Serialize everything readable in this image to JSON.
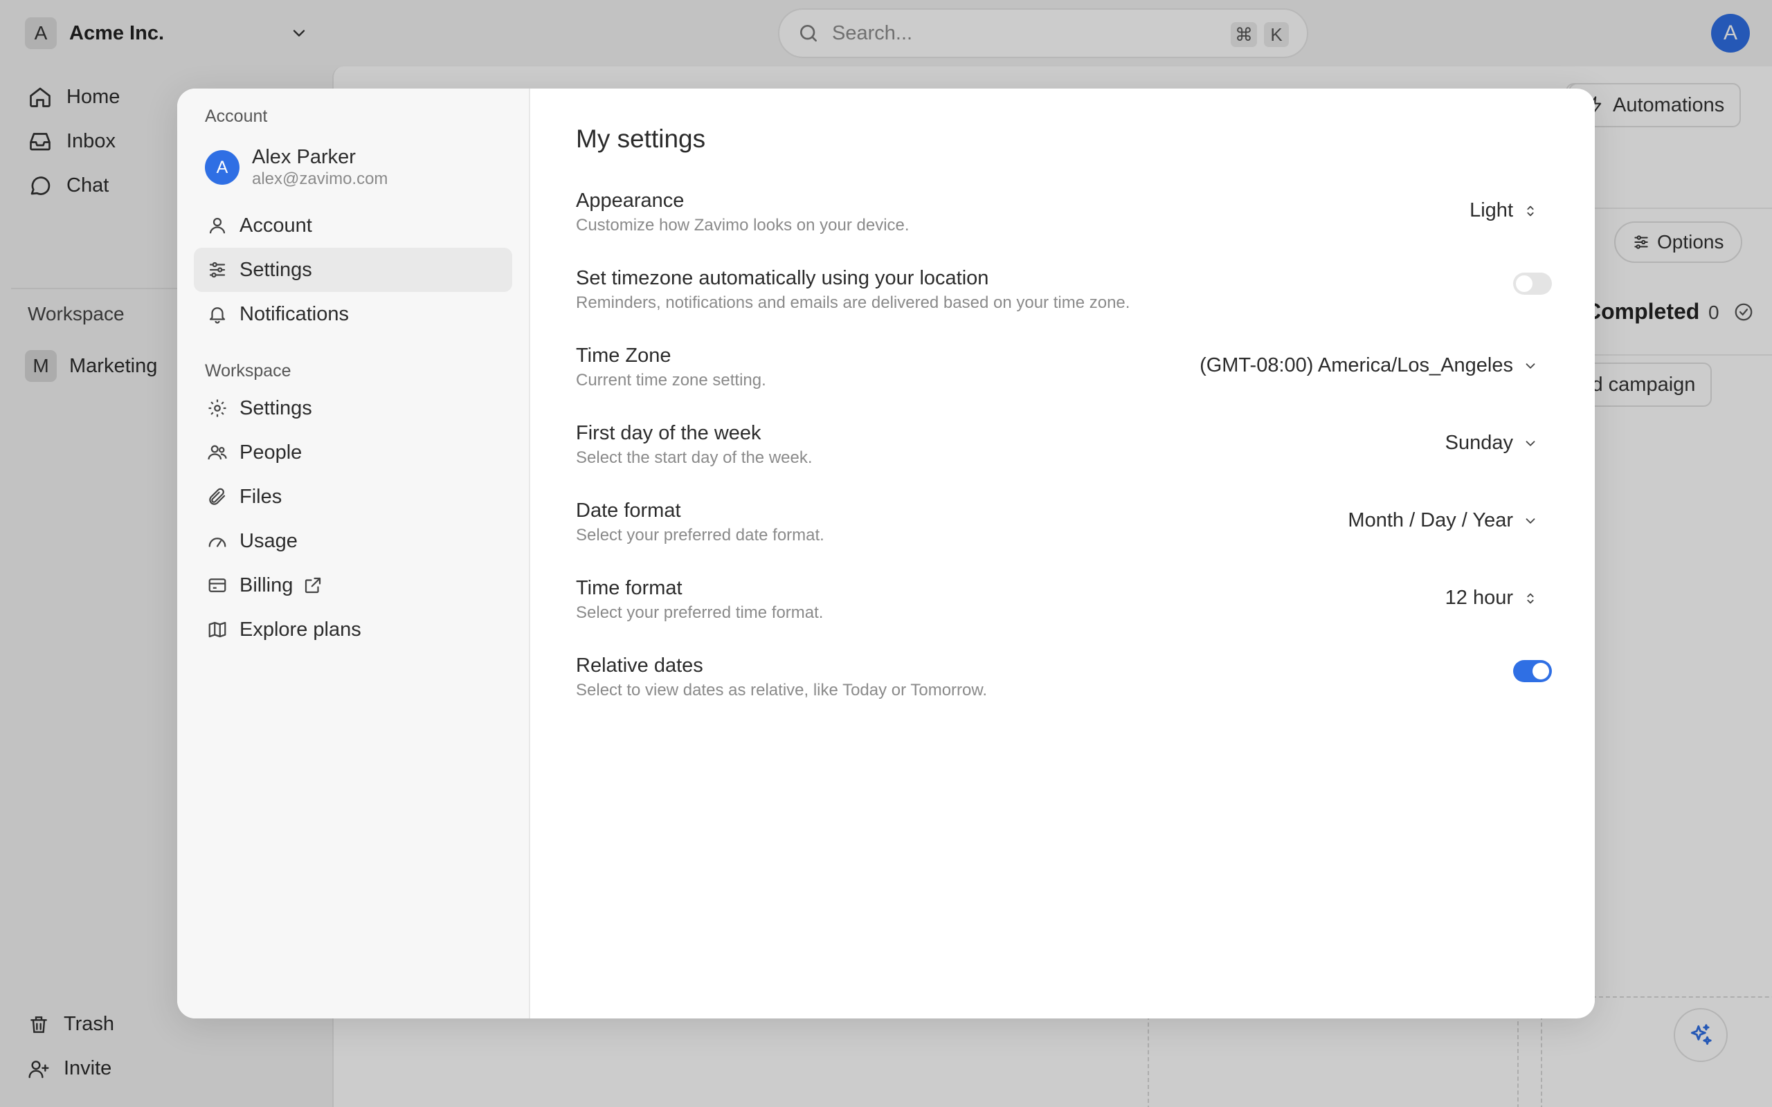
{
  "app": {
    "workspace_initial": "A",
    "workspace_name": "Acme Inc.",
    "search_placeholder": "Search...",
    "shortcut_keys": [
      "⌘",
      "K"
    ],
    "user_initial": "A",
    "accent_color": "#2f6fe4"
  },
  "sidebar": {
    "nav": [
      {
        "label": "Home",
        "icon": "home-icon"
      },
      {
        "label": "Inbox",
        "icon": "inbox-icon"
      },
      {
        "label": "Chat",
        "icon": "chat-icon"
      }
    ],
    "section_title": "Workspace",
    "workspace_item": {
      "initial": "M",
      "label": "Marketing"
    },
    "bottom": [
      {
        "label": "Trash",
        "icon": "trash-icon"
      },
      {
        "label": "Invite",
        "icon": "user-plus-icon"
      }
    ]
  },
  "background": {
    "automations_label": "Automations",
    "options_label": "Options",
    "column_title": "Completed",
    "column_count": "0",
    "add_campaign_label": "Add campaign"
  },
  "modal": {
    "account_section": "Account",
    "user": {
      "initial": "A",
      "name": "Alex Parker",
      "email": "alex@zavimo.com"
    },
    "account_items": [
      {
        "label": "Account",
        "icon": "user-icon"
      },
      {
        "label": "Settings",
        "icon": "sliders-icon",
        "active": true
      },
      {
        "label": "Notifications",
        "icon": "bell-icon"
      }
    ],
    "workspace_section": "Workspace",
    "workspace_items": [
      {
        "label": "Settings",
        "icon": "gear-icon"
      },
      {
        "label": "People",
        "icon": "people-icon"
      },
      {
        "label": "Files",
        "icon": "paperclip-icon"
      },
      {
        "label": "Usage",
        "icon": "gauge-icon"
      },
      {
        "label": "Billing",
        "icon": "credit-card-icon",
        "external": true
      },
      {
        "label": "Explore plans",
        "icon": "map-icon"
      }
    ],
    "title": "My settings",
    "settings": [
      {
        "label": "Appearance",
        "description": "Customize how Zavimo looks on your device.",
        "control": "select",
        "value": "Light",
        "caret": "updown"
      },
      {
        "label": "Set timezone automatically using your location",
        "description": "Reminders, notifications and emails are delivered based on your time zone.",
        "control": "toggle",
        "on": false
      },
      {
        "label": "Time Zone",
        "description": "Current time zone setting.",
        "control": "select",
        "value": "(GMT-08:00) America/Los_Angeles",
        "caret": "down"
      },
      {
        "label": "First day of the week",
        "description": "Select the start day of the week.",
        "control": "select",
        "value": "Sunday",
        "caret": "down"
      },
      {
        "label": "Date format",
        "description": "Select your preferred date format.",
        "control": "select",
        "value": "Month / Day / Year",
        "caret": "down"
      },
      {
        "label": "Time format",
        "description": "Select your preferred time format.",
        "control": "select",
        "value": "12 hour",
        "caret": "updown"
      },
      {
        "label": "Relative dates",
        "description": "Select to view dates as relative, like Today or Tomorrow.",
        "control": "toggle",
        "on": true
      }
    ]
  }
}
